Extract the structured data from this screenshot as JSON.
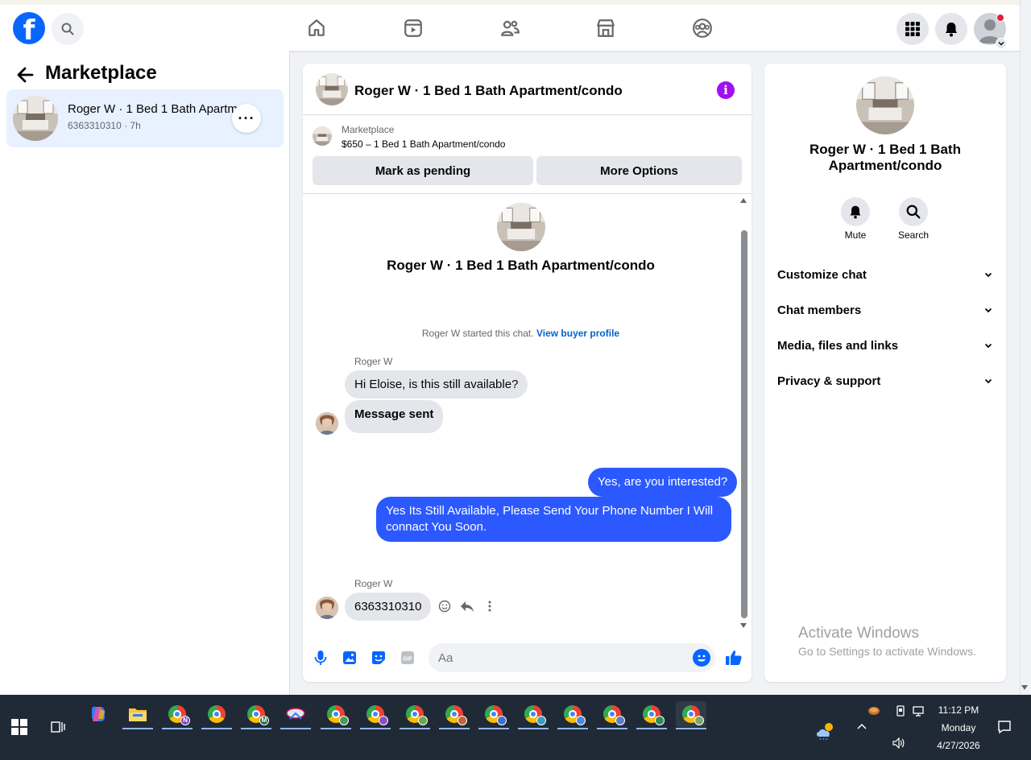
{
  "colors": {
    "brand": "#0866ff",
    "outgoing_bubble": "#2b59ff",
    "incoming_bubble": "#e4e6eb",
    "selected_item": "#e7f1ff",
    "info_icon": "#a20ff2",
    "link": "#0064d1"
  },
  "topbar": {
    "logo_letter": "f",
    "icons": [
      "search-icon",
      "home-icon",
      "video-icon",
      "friends-icon",
      "marketplace-icon",
      "groups-icon",
      "menu-grid-icon",
      "notifications-icon",
      "account-icon"
    ]
  },
  "sidebar": {
    "title": "Marketplace",
    "conversations": [
      {
        "name": "Roger W · 1 Bed 1 Bath Apartm...",
        "sub": "6363310310 · 7h"
      }
    ],
    "more_label": "···"
  },
  "chat": {
    "title": "Roger W · 1 Bed 1 Bath Apartment/condo",
    "info_label": "i",
    "listing": {
      "label": "Marketplace",
      "price_title": "$650 – 1 Bed 1 Bath Apartment/condo",
      "mark_pending": "Mark as pending",
      "more_options": "More Options"
    },
    "intro_title": "Roger W · 1 Bed 1 Bath Apartment/condo",
    "intro_note": "Roger W started this chat.",
    "view_buyer": "View buyer profile",
    "messages": [
      {
        "sender": "Roger W",
        "text": "Hi Eloise, is this still available?"
      },
      {
        "text": "Message sent"
      },
      {
        "text": "Yes, are you interested?"
      },
      {
        "text": "Yes Its Still Available, Please Send Your Phone Number I Will connact You Soon."
      },
      {
        "sender": "Roger W",
        "text": "6363310310"
      }
    ],
    "composer_placeholder": "Aa",
    "composer_icons": [
      "microphone-icon",
      "image-icon",
      "sticker-icon",
      "gif-icon",
      "emoji-icon",
      "like-icon"
    ],
    "gif_label": "GIF"
  },
  "details": {
    "title": "Roger W · 1 Bed 1 Bath Apartment/condo",
    "mute": "Mute",
    "search": "Search",
    "sections": [
      "Customize chat",
      "Chat members",
      "Media, files and links",
      "Privacy & support"
    ],
    "watermark_title": "Activate Windows",
    "watermark_sub": "Go to Settings to activate Windows."
  },
  "taskbar": {
    "time": "11:12 PM",
    "day": "Monday",
    "date": "4/27/2026",
    "chrome_profiles": [
      "N",
      "",
      "M"
    ]
  }
}
